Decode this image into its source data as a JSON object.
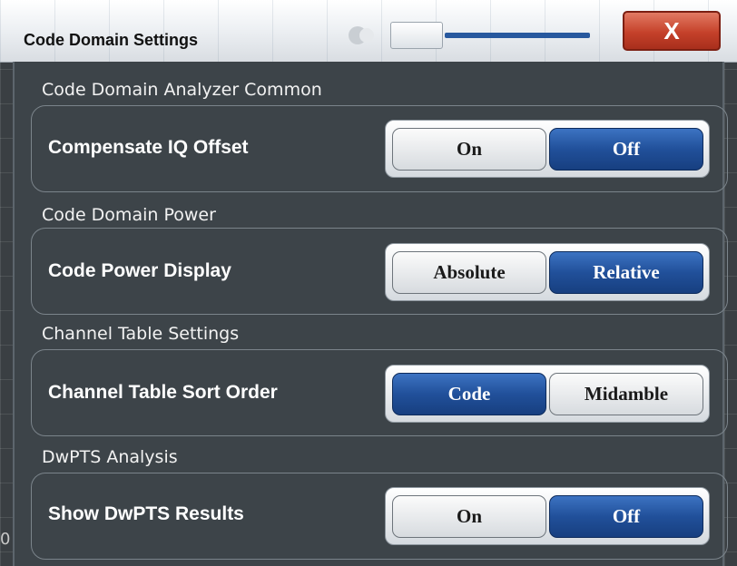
{
  "dialog": {
    "title": "Code Domain Settings",
    "close_label": "X"
  },
  "sections": [
    {
      "heading": "Code Domain Analyzer Common",
      "setting": "Compensate IQ Offset",
      "options": [
        "On",
        "Off"
      ],
      "selected": "Off"
    },
    {
      "heading": "Code Domain Power",
      "setting": "Code Power Display",
      "options": [
        "Absolute",
        "Relative"
      ],
      "selected": "Relative"
    },
    {
      "heading": "Channel Table Settings",
      "setting": "Channel Table Sort Order",
      "options": [
        "Code",
        "Midamble"
      ],
      "selected": "Code"
    },
    {
      "heading": "DwPTS Analysis",
      "setting": "Show DwPTS Results",
      "options": [
        "On",
        "Off"
      ],
      "selected": "Off"
    }
  ],
  "background_edge_text": "0",
  "colors": {
    "active_option": "#21509a",
    "close_button": "#c5412a",
    "dialog_body": "#3d4449"
  }
}
